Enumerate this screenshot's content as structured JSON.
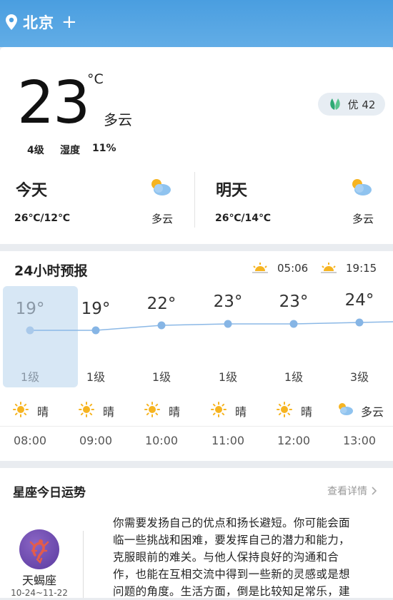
{
  "header": {
    "city": "北京",
    "add_icon": "+"
  },
  "current": {
    "temperature": "23",
    "unit": "°C",
    "condition": "多云",
    "wind": "4级",
    "humidity_label": "湿度",
    "humidity_value": "11%",
    "aqi_label": "优 42"
  },
  "today": {
    "title": "今天",
    "range": "26℃/12℃",
    "condition": "多云",
    "icon": "cloud-sun-icon"
  },
  "tomorrow": {
    "title": "明天",
    "range": "26℃/14℃",
    "condition": "多云",
    "icon": "cloud-sun-icon"
  },
  "forecast": {
    "title": "24小时预报",
    "sunrise": "05:06",
    "sunset": "19:15",
    "hours": [
      {
        "temp": "19°",
        "value": 19,
        "wind": "1级",
        "condition": "晴",
        "icon": "sun-icon",
        "time": "08:00"
      },
      {
        "temp": "19°",
        "value": 19,
        "wind": "1级",
        "condition": "晴",
        "icon": "sun-icon",
        "time": "09:00"
      },
      {
        "temp": "22°",
        "value": 22,
        "wind": "1级",
        "condition": "晴",
        "icon": "sun-icon",
        "time": "10:00"
      },
      {
        "temp": "23°",
        "value": 23,
        "wind": "1级",
        "condition": "晴",
        "icon": "sun-icon",
        "time": "11:00"
      },
      {
        "temp": "23°",
        "value": 23,
        "wind": "1级",
        "condition": "晴",
        "icon": "sun-icon",
        "time": "12:00"
      },
      {
        "temp": "24°",
        "value": 24,
        "wind": "3级",
        "condition": "多云",
        "icon": "cloud-sun-icon",
        "time": "13:00"
      }
    ]
  },
  "horoscope": {
    "title": "星座今日运势",
    "more": "查看详情",
    "sign": "天蝎座",
    "dates": "10-24~11-22",
    "text": "你需要发扬自己的优点和扬长避短。你可能会面临一些挑战和困难，要发挥自己的潜力和能力，克服眼前的难关。与他人保持良好的沟通和合作，也能在互相交流中得到一些新的灵感或是想问题的角度。生活方面，倒是比较知足常乐，建"
  },
  "colors": {
    "accent": "#4a9ee0",
    "line": "#8bb8e6",
    "sun": "#f6b421"
  }
}
